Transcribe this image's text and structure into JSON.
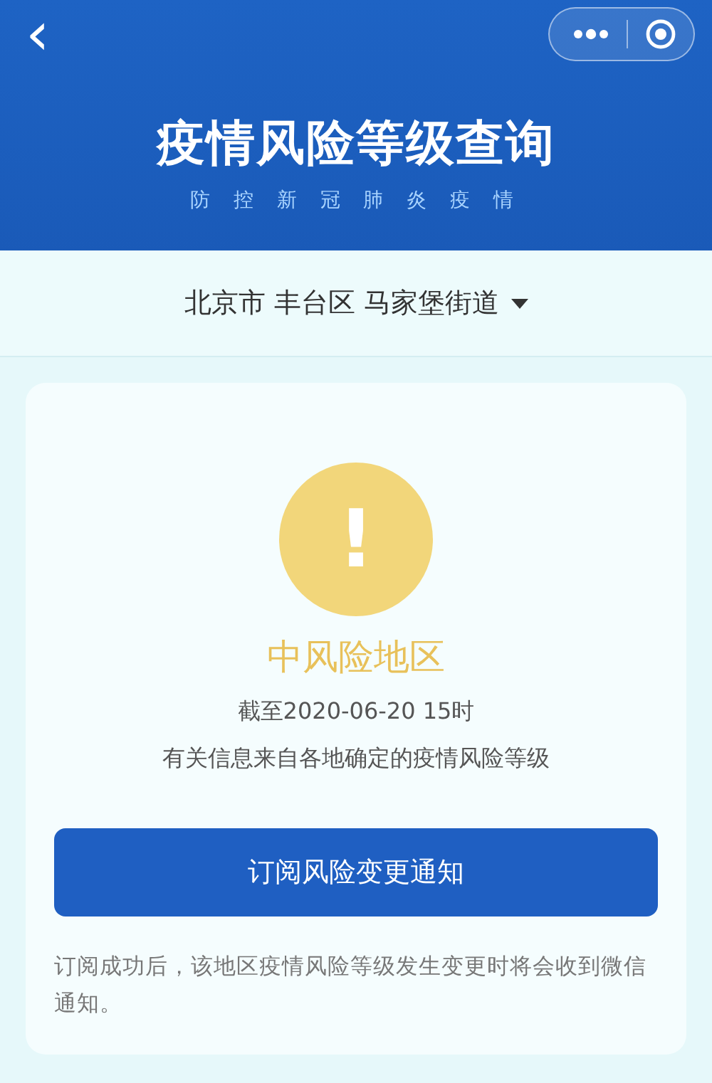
{
  "header": {
    "back": "‹",
    "title": "疫情风险等级查询",
    "subtitle": "防 控 新 冠 肺 炎 疫 情"
  },
  "location": {
    "text": "北京市 丰台区 马家堡街道"
  },
  "risk": {
    "icon": "!",
    "level": "中风险地区",
    "date": "截至2020-06-20 15时",
    "info": "有关信息来自各地确定的疫情风险等级"
  },
  "subscribe_button": "订阅风险变更通知",
  "note": "订阅成功后，该地区疫情风险等级发生变更时将会收到微信通知。"
}
